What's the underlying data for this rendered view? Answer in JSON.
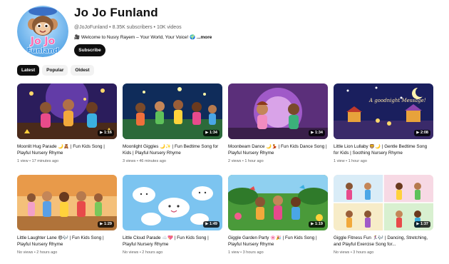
{
  "channel": {
    "name": "Jo Jo Funland",
    "handle": "@JoJoFunland",
    "subscribers": "8.35K subscribers",
    "videos_count": "10K videos",
    "description": "Welcome to Nusry Rayem – Your World, Your Voice!",
    "more_label": "...more",
    "subscribe_label": "Subscribe",
    "avatar_logo_text": "Jo Jo Funland"
  },
  "filters": [
    {
      "label": "Latest",
      "active": true
    },
    {
      "label": "Popular",
      "active": false
    },
    {
      "label": "Oldest",
      "active": false
    }
  ],
  "videos": [
    {
      "title": "Moonlit Hug Parade 🌙🧸 | Fun Kids Song | Playful Nursery Rhyme",
      "duration": "1:16",
      "views": "1 view",
      "age": "17 minutes ago"
    },
    {
      "title": "Moonlight Giggles 🌙✨ | Fun Bedtime Song for Kids | Playful Nursery Rhyme",
      "duration": "1:34",
      "views": "3 views",
      "age": "46 minutes ago"
    },
    {
      "title": "Moonbeam Dance 🌙💃 | Fun Kids Dance Song | Playful Nursery Rhyme",
      "duration": "1:34",
      "views": "2 views",
      "age": "1 hour ago"
    },
    {
      "title": "Little Lion Lullaby 🦁🌙 | Gentle Bedtime Song for Kids | Soothing Nursery Rhyme",
      "duration": "2:08",
      "views": "1 view",
      "age": "1 hour ago"
    },
    {
      "title": "Little Laughter Lane 😄🎶 | Fun Kids Song | Playful Nursery Rhyme",
      "duration": "1:29",
      "views": "No views",
      "age": "2 hours ago"
    },
    {
      "title": "Little Cloud Parade ☁️💖 | Fun Kids Song | Playful Nursery Rhyme",
      "duration": "1:49",
      "views": "No views",
      "age": "2 hours ago"
    },
    {
      "title": "Giggle Garden Party 🌸🎉 | Fun Kids Song | Playful Nursery Rhyme",
      "duration": "1:19",
      "views": "1 view",
      "age": "3 hours ago"
    },
    {
      "title": "Giggle Fitness Fun 🏃‍♀️🎶 | Dancing, Stretching, and Playful Exercise Song for...",
      "duration": "1:37",
      "views": "No views",
      "age": "3 hours ago"
    }
  ],
  "thumb_overlay_text": "A goodnight Message!"
}
